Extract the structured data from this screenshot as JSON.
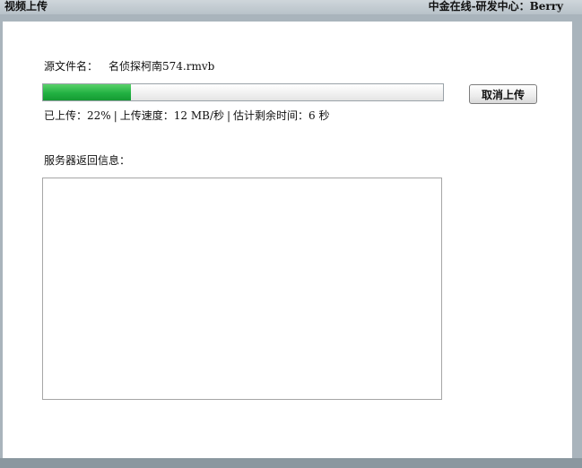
{
  "window": {
    "title": "视频上传",
    "brand": "中金在线-研发中心：Berry"
  },
  "upload": {
    "source_label": "源文件名：",
    "file_name": "名侦探柯南574.rmvb",
    "progress_fraction": 0.22,
    "cancel_label": "取消上传",
    "status": {
      "uploaded_label": "已上传：",
      "uploaded_value": "22%",
      "separator": "|",
      "speed_label": "上传速度：",
      "speed_value": "12 MB/秒",
      "remaining_label": "估计剩余时间：",
      "remaining_value": "6 秒"
    }
  },
  "server": {
    "label": "服务器返回信息：",
    "response": ""
  },
  "colors": {
    "progress_fill": "#22b142",
    "background": "#a9b4bc",
    "panel": "#ffffff"
  }
}
